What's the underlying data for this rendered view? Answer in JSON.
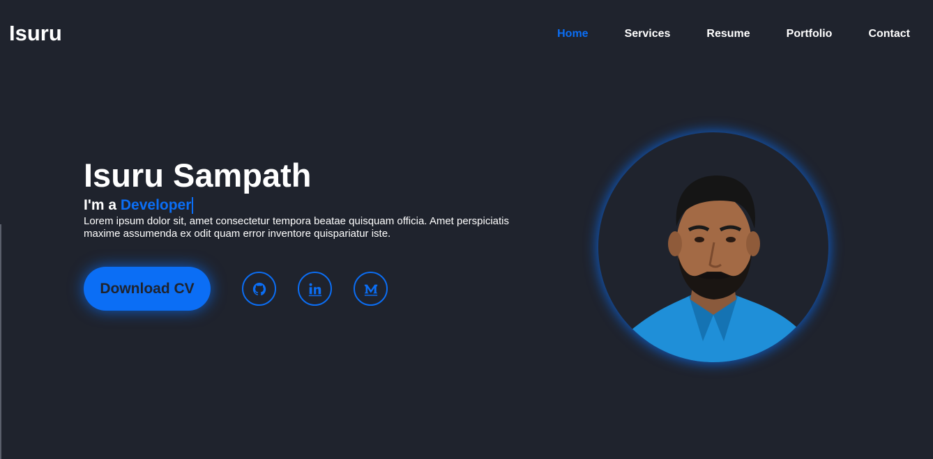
{
  "header": {
    "logo": "Isuru",
    "nav": [
      {
        "label": "Home",
        "active": true
      },
      {
        "label": "Services",
        "active": false
      },
      {
        "label": "Resume",
        "active": false
      },
      {
        "label": "Portfolio",
        "active": false
      },
      {
        "label": "Contact",
        "active": false
      }
    ]
  },
  "hero": {
    "name": "Isuru Sampath",
    "intro_prefix": "I'm a",
    "role": "Developer",
    "description": "Lorem ipsum dolor sit, amet consectetur tempora beatae quisquam officia. Amet perspiciatis maxime assumenda ex odit quam error inventore quispariatur iste.",
    "download_label": "Download CV"
  },
  "social": [
    {
      "name": "github-icon"
    },
    {
      "name": "linkedin-icon"
    },
    {
      "name": "medium-icon"
    }
  ],
  "colors": {
    "background": "#1f232d",
    "accent": "#0b6ef5",
    "text": "#ffffff"
  }
}
